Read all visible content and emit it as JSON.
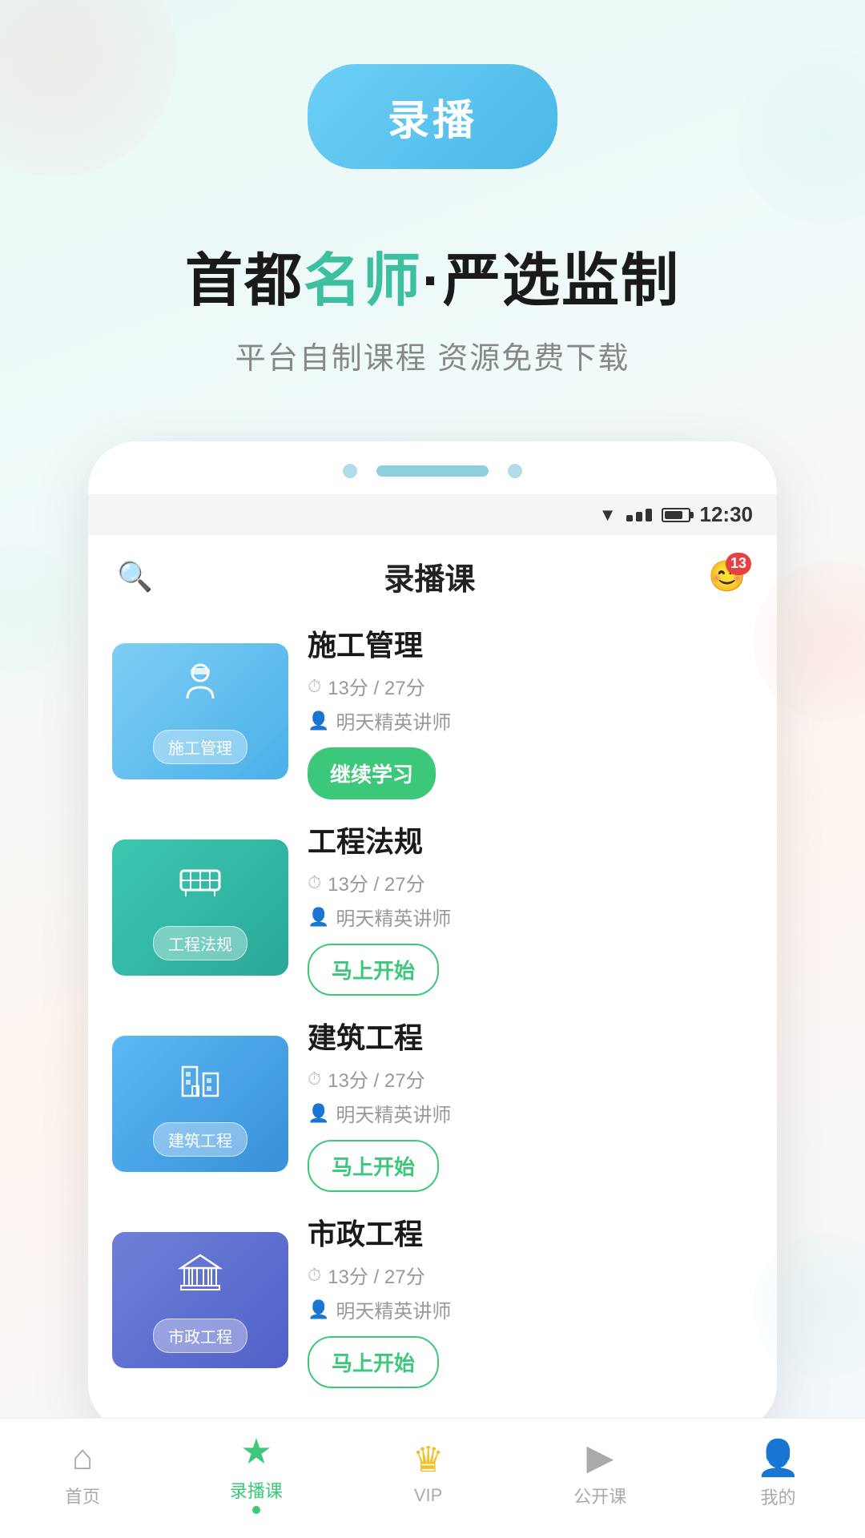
{
  "app": {
    "top_button": "录播",
    "headline_main_prefix": "首都",
    "headline_main_highlight": "名师",
    "headline_main_suffix": "·严选监制",
    "headline_sub": "平台自制课程 资源免费下载",
    "status_time": "12:30",
    "header_title": "录播课",
    "message_badge": "13"
  },
  "courses": [
    {
      "id": 1,
      "title": "施工管理",
      "thumb_label": "施工管理",
      "thumb_class": "thumb-1",
      "duration": "13分 / 27分",
      "teacher": "明天精英讲师",
      "action_type": "continue",
      "action_label": "继续学习",
      "icon": "👷"
    },
    {
      "id": 2,
      "title": "工程法规",
      "thumb_label": "工程法规",
      "thumb_class": "thumb-2",
      "duration": "13分 / 27分",
      "teacher": "明天精英讲师",
      "action_type": "start",
      "action_label": "马上开始",
      "icon": "🚧"
    },
    {
      "id": 3,
      "title": "建筑工程",
      "thumb_label": "建筑工程",
      "thumb_class": "thumb-3",
      "duration": "13分 / 27分",
      "teacher": "明天精英讲师",
      "action_type": "start",
      "action_label": "马上开始",
      "icon": "🏢"
    },
    {
      "id": 4,
      "title": "市政工程",
      "thumb_label": "市政工程",
      "thumb_class": "thumb-4",
      "duration": "13分 / 27分",
      "teacher": "明天精英讲师",
      "action_type": "start",
      "action_label": "马上开始",
      "icon": "🏛"
    }
  ],
  "nav": {
    "items": [
      {
        "label": "首页",
        "icon": "⌂",
        "active": false
      },
      {
        "label": "录播课",
        "icon": "★",
        "active": true
      },
      {
        "label": "VIP",
        "icon": "♛",
        "active": false,
        "vip": true
      },
      {
        "label": "公开课",
        "icon": "▶",
        "active": false
      },
      {
        "label": "我的",
        "icon": "👤",
        "active": false
      }
    ]
  }
}
